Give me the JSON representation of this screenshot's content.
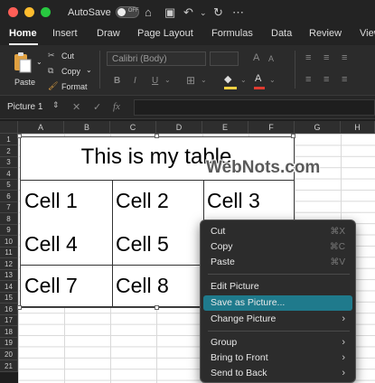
{
  "titlebar": {
    "autosave_label": "AutoSave",
    "toggle_state": "OFF",
    "icons": [
      "home-icon",
      "save-icon",
      "undo-icon",
      "chevron-down-icon",
      "redo-icon",
      "more-icon"
    ]
  },
  "tabs": [
    "Home",
    "Insert",
    "Draw",
    "Page Layout",
    "Formulas",
    "Data",
    "Review",
    "View"
  ],
  "ribbon": {
    "paste_label": "Paste",
    "cut_label": "Cut",
    "copy_label": "Copy",
    "format_label": "Format",
    "font_name": "Calibri (Body)",
    "bold": "B",
    "italic": "I",
    "underline": "U"
  },
  "formula_bar": {
    "name_box": "Picture 1",
    "fx_label": "fx",
    "cancel": "✕",
    "enter": "✓"
  },
  "columns": [
    "A",
    "B",
    "C",
    "D",
    "E",
    "F",
    "G",
    "H"
  ],
  "rows": [
    "1",
    "2",
    "3",
    "4",
    "5",
    "6",
    "7",
    "8",
    "9",
    "10",
    "11",
    "12",
    "13",
    "14",
    "15",
    "16",
    "17",
    "18",
    "19",
    "20",
    "21"
  ],
  "picture": {
    "title": "This is my table",
    "cells": [
      "Cell 1",
      "Cell 2",
      "Cell 3",
      "Cell 4",
      "Cell 5",
      "Cell 7",
      "Cell 8"
    ]
  },
  "watermark": "WebNots.com",
  "context_menu": {
    "items": [
      {
        "label": "Cut",
        "shortcut": "⌘X"
      },
      {
        "label": "Copy",
        "shortcut": "⌘C"
      },
      {
        "label": "Paste",
        "shortcut": "⌘V"
      },
      {
        "label": "Edit Picture",
        "shortcut": ""
      },
      {
        "label": "Save as Picture...",
        "shortcut": ""
      },
      {
        "label": "Change Picture",
        "shortcut": ""
      },
      {
        "label": "Group",
        "shortcut": ""
      },
      {
        "label": "Bring to Front",
        "shortcut": ""
      },
      {
        "label": "Send to Back",
        "shortcut": ""
      }
    ],
    "highlight_color": "#1f7a8c"
  },
  "colors": {
    "accent": "#1f7a8c",
    "close": "#ff5f57",
    "minimize": "#febc2e",
    "maximize": "#28c840",
    "fill_yellow": "#f5d142",
    "font_red": "#e03c31"
  }
}
